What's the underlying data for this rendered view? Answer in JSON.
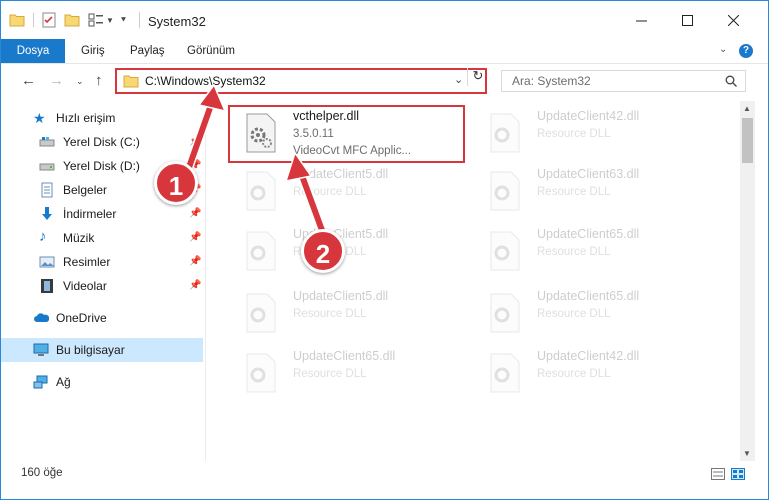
{
  "window": {
    "title": "System32"
  },
  "ribbon": {
    "file": "Dosya",
    "tabs": [
      "Giriş",
      "Paylaş",
      "Görünüm"
    ]
  },
  "navbar": {
    "address": "C:\\Windows\\System32",
    "search_placeholder": "Ara: System32"
  },
  "sidebar": {
    "items": [
      {
        "label": "Hızlı erişim"
      },
      {
        "label": "Yerel Disk (C:)"
      },
      {
        "label": "Yerel Disk (D:)"
      },
      {
        "label": "Belgeler"
      },
      {
        "label": "İndirmeler"
      },
      {
        "label": "Müzik"
      },
      {
        "label": "Resimler"
      },
      {
        "label": "Videolar"
      },
      {
        "label": "OneDrive"
      },
      {
        "label": "Bu bilgisayar"
      },
      {
        "label": "Ağ"
      }
    ]
  },
  "files": [
    {
      "name": "vcthelper.dll",
      "version": "3.5.0.11",
      "description": "VideoCvt MFC Applic..."
    },
    {
      "name": "UpdateClient42.dll",
      "description": "Resource DLL"
    },
    {
      "name": "UpdateClient5.dll",
      "description": "Resource DLL"
    },
    {
      "name": "UpdateClient63.dll",
      "description": "Resource DLL"
    },
    {
      "name": "UpdateClient5.dll",
      "description": "Resource DLL"
    },
    {
      "name": "UpdateClient65.dll",
      "description": "Resource DLL"
    },
    {
      "name": "UpdateClient5.dll",
      "description": "Resource DLL"
    },
    {
      "name": "UpdateClient65.dll",
      "description": "Resource DLL"
    },
    {
      "name": "UpdateClient65.dll",
      "description": "Resource DLL"
    },
    {
      "name": "UpdateClient42.dll",
      "description": "Resource DLL"
    }
  ],
  "status": {
    "count": "160 öğe"
  },
  "annotations": {
    "step1": "1",
    "step2": "2"
  },
  "colors": {
    "accent": "#1979ca",
    "annotation": "#d8363d",
    "selection": "#cce8ff"
  }
}
